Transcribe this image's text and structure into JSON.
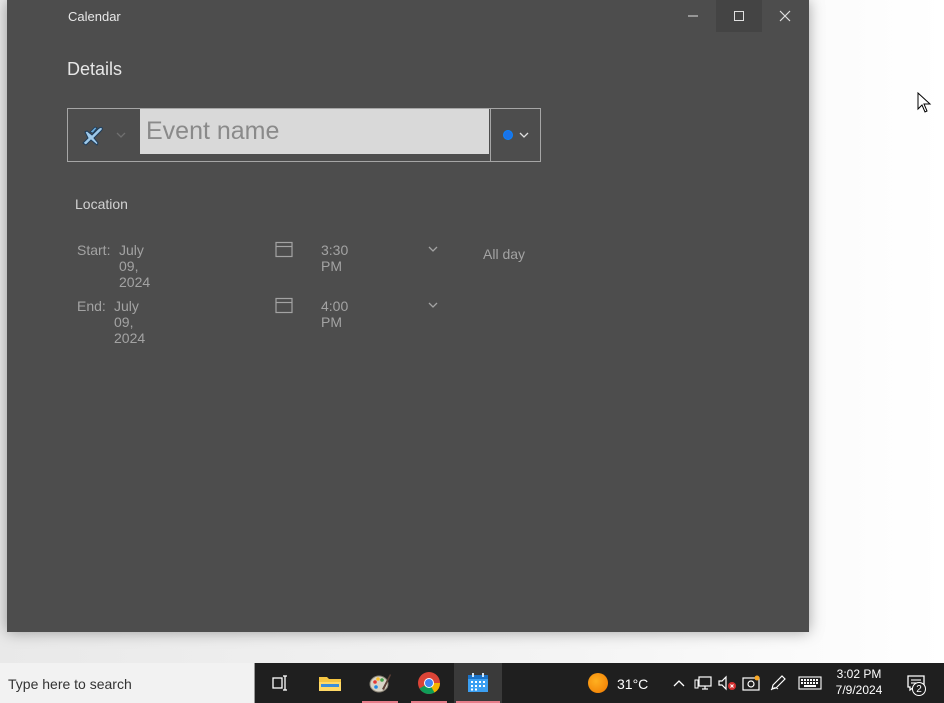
{
  "window": {
    "app_title": "Calendar",
    "heading": "Details"
  },
  "event": {
    "name_value": "",
    "name_placeholder": "Event name",
    "icon": "airplane-icon",
    "color": "#1a73e8"
  },
  "location_label": "Location",
  "start": {
    "label": "Start:",
    "date": "July 09, 2024",
    "time": "3:30 PM"
  },
  "end": {
    "label": "End:",
    "date": "July 09, 2024",
    "time": "4:00 PM"
  },
  "all_day_label": "All day",
  "taskbar": {
    "search_placeholder": "Type here to search",
    "weather_temp": "31°C",
    "time": "3:02 PM",
    "date": "7/9/2024",
    "notification_count": "2"
  },
  "colors": {
    "window_bg": "#4d4d4d",
    "accent": "#1a73e8",
    "taskbar_bg": "#1f1f1f"
  }
}
